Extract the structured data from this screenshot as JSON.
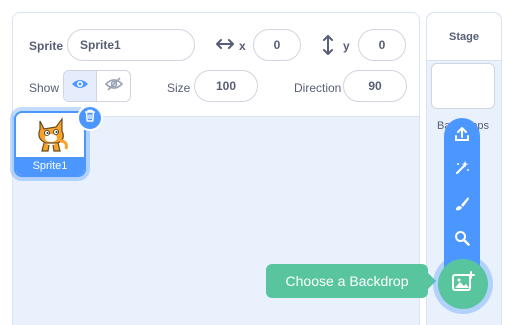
{
  "sprite_info": {
    "sprite_label": "Sprite",
    "sprite_name": "Sprite1",
    "x_label": "x",
    "x_value": "0",
    "y_label": "y",
    "y_value": "0",
    "show_label": "Show",
    "size_label": "Size",
    "size_value": "100",
    "direction_label": "Direction",
    "direction_value": "90"
  },
  "sprites": [
    {
      "name": "Sprite1",
      "selected": true
    }
  ],
  "stage": {
    "title": "Stage",
    "backdrops_label": "Backdrops"
  },
  "backdrop_menu": {
    "tooltip": "Choose a Backdrop",
    "items": [
      "upload-icon",
      "surprise-icon",
      "paint-icon",
      "search-icon"
    ],
    "main_icon": "backdrop-add-icon"
  },
  "colors": {
    "accent": "#4c97ff",
    "green": "#59c59f",
    "panel_bg": "#e9f1fc",
    "text": "#575e75"
  }
}
